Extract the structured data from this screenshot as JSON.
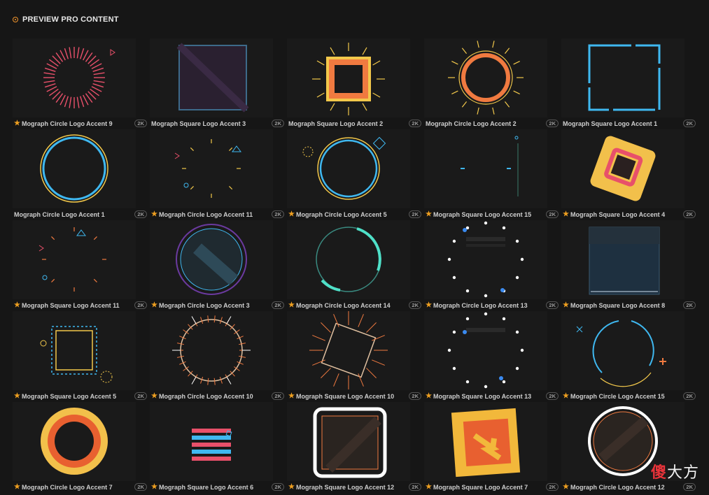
{
  "header": {
    "title": "PREVIEW PRO CONTENT",
    "icon": "radio-dot-icon"
  },
  "colors": {
    "accent": "#f0932b",
    "star": "#f0a020",
    "background": "#161616"
  },
  "badge_label": "2K",
  "items": [
    {
      "title": "Mograph Circle Logo Accent 9",
      "pro": true,
      "art": "c9"
    },
    {
      "title": "Mograph Square Logo Accent 3",
      "pro": false,
      "art": "s3"
    },
    {
      "title": "Mograph Square Logo Accent 2",
      "pro": false,
      "art": "s2"
    },
    {
      "title": "Mograph Circle Logo Accent 2",
      "pro": false,
      "art": "c2"
    },
    {
      "title": "Mograph Square Logo Accent 1",
      "pro": false,
      "art": "s1"
    },
    {
      "title": "Mograph Circle Logo Accent 1",
      "pro": false,
      "art": "c1"
    },
    {
      "title": "Mograph Circle Logo Accent 11",
      "pro": true,
      "art": "c11"
    },
    {
      "title": "Mograph Circle Logo Accent 5",
      "pro": true,
      "art": "c5"
    },
    {
      "title": "Mograph Square Logo Accent 15",
      "pro": true,
      "art": "s15"
    },
    {
      "title": "Mograph Square Logo Accent 4",
      "pro": true,
      "art": "s4"
    },
    {
      "title": "Mograph Square Logo Accent 11",
      "pro": true,
      "art": "s11"
    },
    {
      "title": "Mograph Circle Logo Accent 3",
      "pro": true,
      "art": "c3"
    },
    {
      "title": "Mograph Circle Logo Accent 14",
      "pro": true,
      "art": "c14"
    },
    {
      "title": "Mograph Circle Logo Accent 13",
      "pro": true,
      "art": "c13"
    },
    {
      "title": "Mograph Square Logo Accent 8",
      "pro": true,
      "art": "s8"
    },
    {
      "title": "Mograph Square Logo Accent 5",
      "pro": true,
      "art": "s5"
    },
    {
      "title": "Mograph Circle Logo Accent 10",
      "pro": true,
      "art": "c10"
    },
    {
      "title": "Mograph Square Logo Accent 10",
      "pro": true,
      "art": "s10"
    },
    {
      "title": "Mograph Square Logo Accent 13",
      "pro": true,
      "art": "s13"
    },
    {
      "title": "Mograph Circle Logo Accent 15",
      "pro": true,
      "art": "c15"
    },
    {
      "title": "Mograph Circle Logo Accent 7",
      "pro": true,
      "art": "c7"
    },
    {
      "title": "Mograph Square Logo Accent 6",
      "pro": true,
      "art": "s6"
    },
    {
      "title": "Mograph Square Logo Accent 12",
      "pro": true,
      "art": "s12"
    },
    {
      "title": "Mograph Square Logo Accent 7",
      "pro": true,
      "art": "s7"
    },
    {
      "title": "Mograph Circle Logo Accent 12",
      "pro": true,
      "art": "c12"
    }
  ],
  "watermark": {
    "text": "傻大方"
  }
}
